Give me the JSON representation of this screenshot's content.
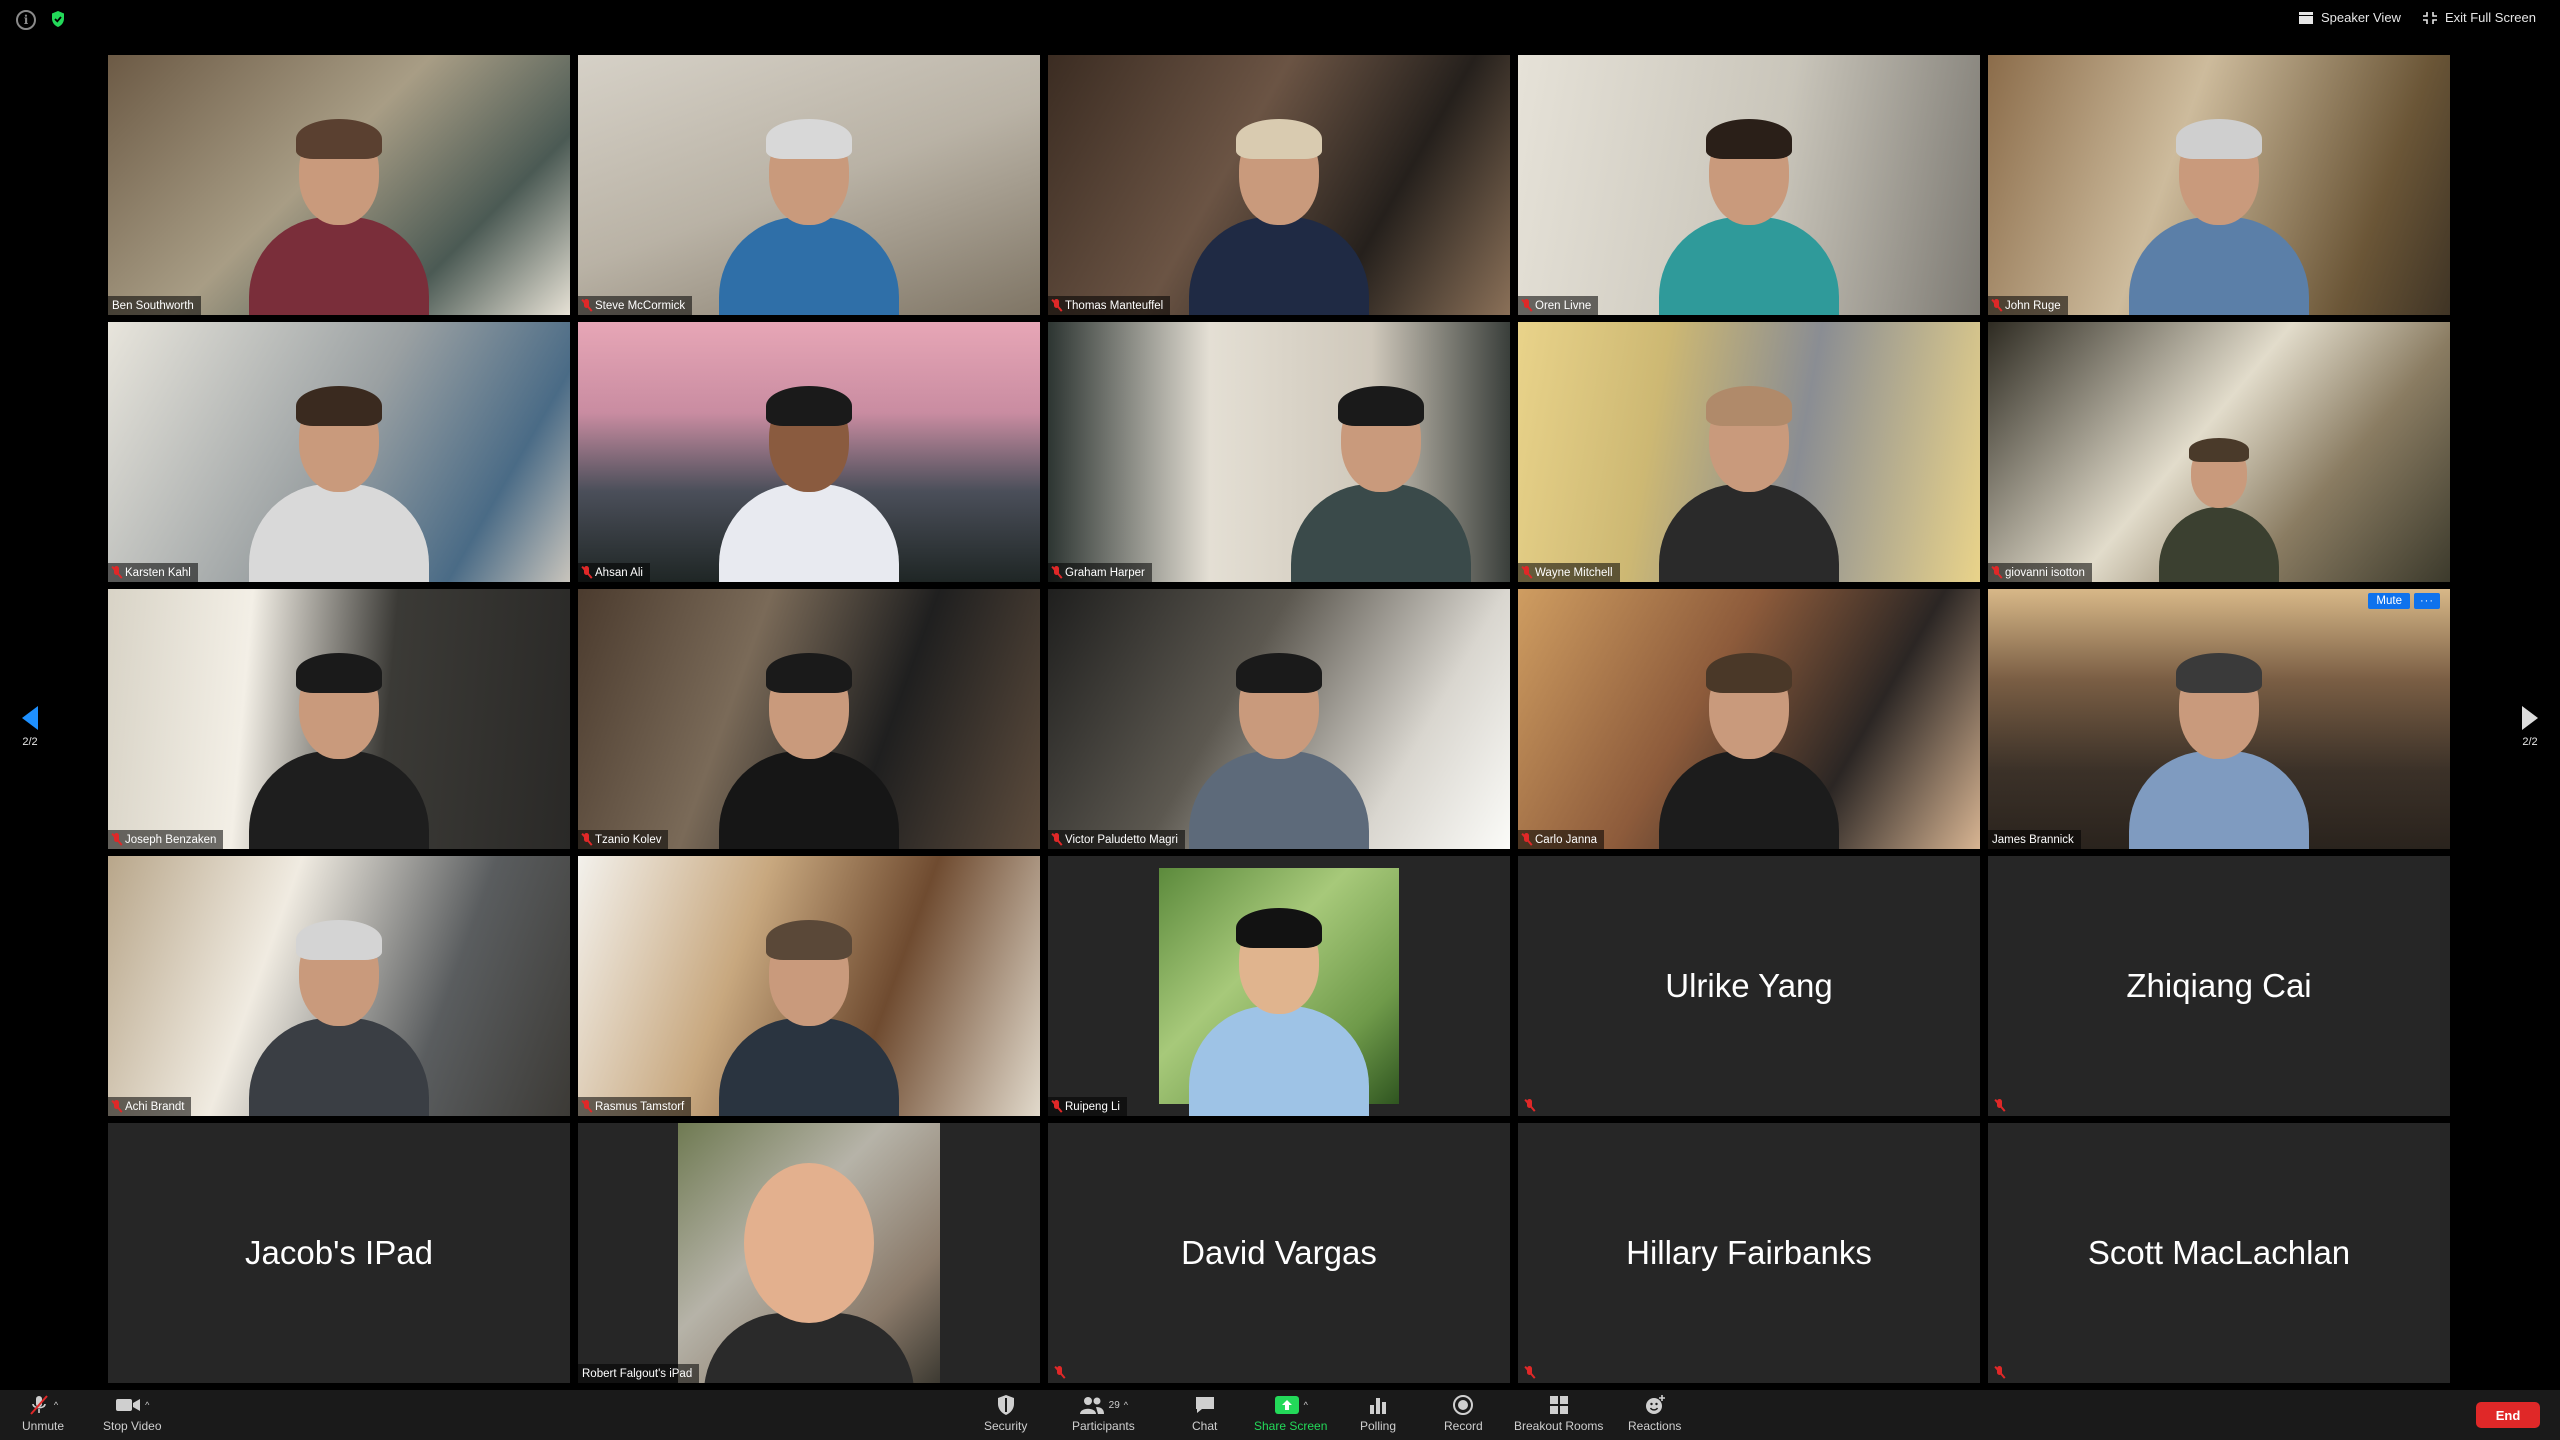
{
  "window": {
    "top_buttons": {
      "speaker_view": "Speaker View",
      "exit_full_screen": "Exit Full Screen"
    }
  },
  "pagination": {
    "left": "2/2",
    "right": "2/2"
  },
  "participants": [
    {
      "name": "Ben Southworth"
    },
    {
      "name": "Steve McCormick"
    },
    {
      "name": "Thomas Manteuffel"
    },
    {
      "name": "Oren Livne"
    },
    {
      "name": "John Ruge"
    },
    {
      "name": "Karsten Kahl"
    },
    {
      "name": "Ahsan Ali"
    },
    {
      "name": "Graham Harper"
    },
    {
      "name": "Wayne Mitchell"
    },
    {
      "name": "giovanni isotton"
    },
    {
      "name": "Joseph Benzaken"
    },
    {
      "name": "Tzanio Kolev"
    },
    {
      "name": "Victor Paludetto Magri"
    },
    {
      "name": "Carlo Janna"
    },
    {
      "name": "James Brannick"
    },
    {
      "name": "Achi Brandt"
    },
    {
      "name": "Rasmus Tamstorf"
    },
    {
      "name": "Ruipeng Li"
    },
    {
      "name": "Ulrike Yang"
    },
    {
      "name": "Zhiqiang Cai"
    },
    {
      "name": "Jacob's IPad"
    },
    {
      "name": "Robert Falgout's iPad"
    },
    {
      "name": "David Vargas"
    },
    {
      "name": "Hillary Fairbanks"
    },
    {
      "name": "Scott MacLachlan"
    }
  ],
  "active_tile": {
    "mute_label": "Mute",
    "more_label": "···"
  },
  "toolbar": {
    "unmute": "Unmute",
    "stop_video": "Stop Video",
    "security": "Security",
    "participants": "Participants",
    "participants_count": "29",
    "chat": "Chat",
    "share_screen": "Share Screen",
    "polling": "Polling",
    "record": "Record",
    "breakout_rooms": "Breakout Rooms",
    "reactions": "Reactions",
    "end": "End"
  },
  "colors": {
    "accent": "#0e72ed",
    "active_speaker": "#b5e61d",
    "share_green": "#23d959",
    "end_red": "#e02828",
    "muted_red": "#e02828"
  }
}
